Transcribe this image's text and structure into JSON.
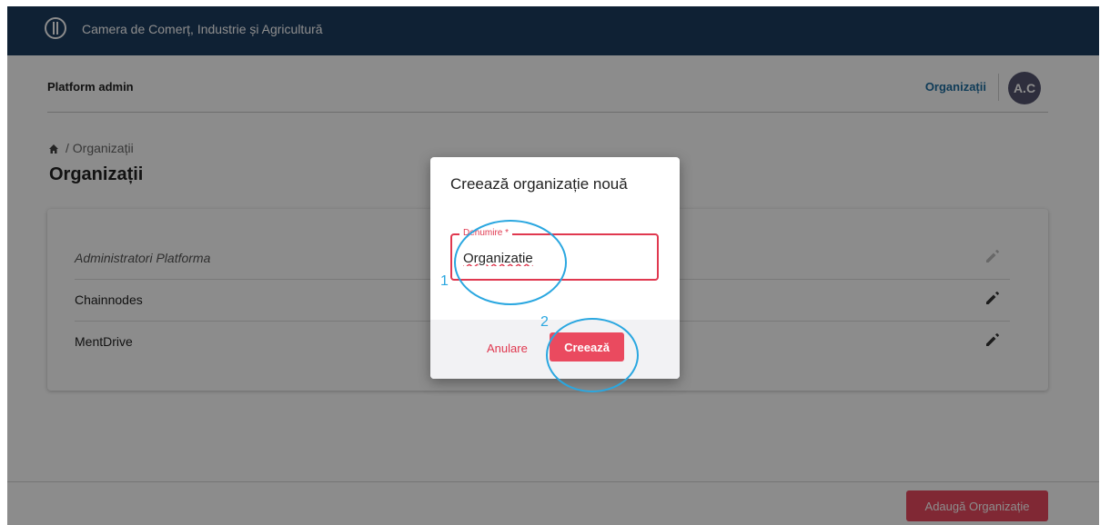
{
  "app": {
    "org_name": "Camera de Comerț, Industrie și Agricultură",
    "section": "Platform admin",
    "nav_link": "Organizații",
    "avatar_initials": "A.C"
  },
  "breadcrumb": {
    "current": "Organizații"
  },
  "page": {
    "title": "Organizații"
  },
  "organizations": [
    {
      "name": "Administratori Platforma"
    },
    {
      "name": "Chainnodes"
    },
    {
      "name": "MentDrive"
    }
  ],
  "footer": {
    "add_label": "Adaugă Organizație"
  },
  "dialog": {
    "title": "Creează organizație nouă",
    "field_label": "Denumire *",
    "field_value": "Organizatie",
    "cancel_label": "Anulare",
    "create_label": "Creează"
  },
  "annotations": [
    "1",
    "2"
  ],
  "colors": {
    "topbar": "#1d3c5f",
    "accent": "#ea4a5f",
    "link": "#1e6ea1",
    "annotation": "#2aa7e0"
  },
  "icons": {
    "home": "home-icon",
    "edit": "pencil-icon",
    "logo": "caduceus-logo-icon"
  }
}
